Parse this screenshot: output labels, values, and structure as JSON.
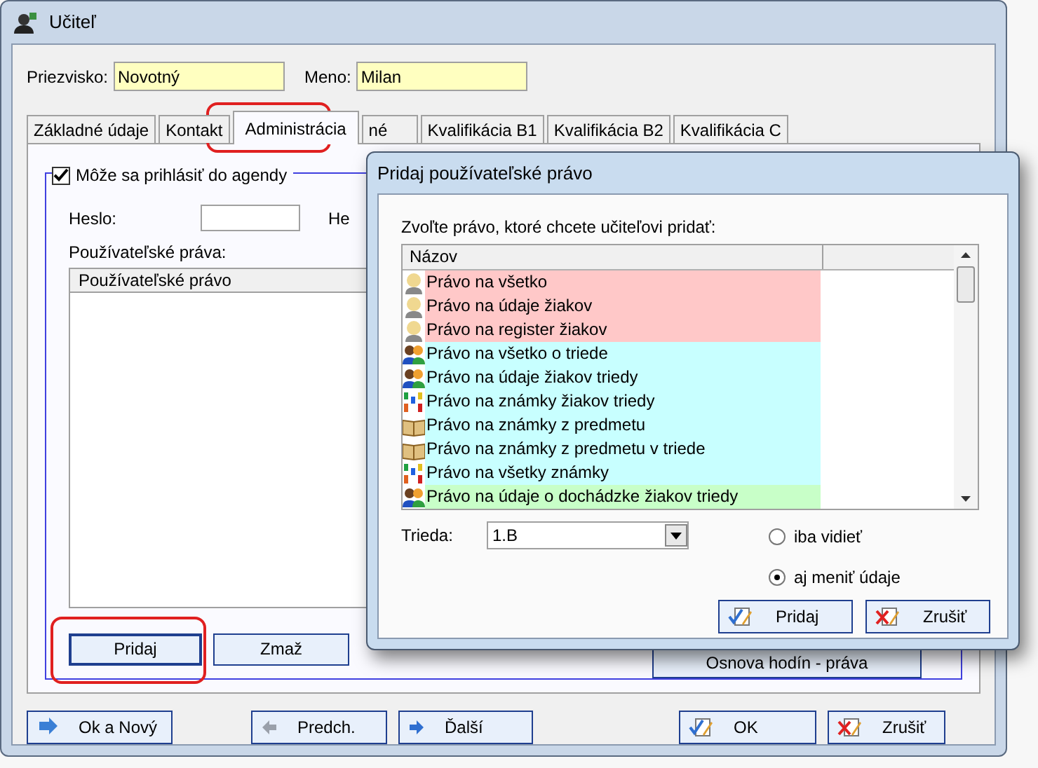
{
  "window": {
    "title": "Učiteľ"
  },
  "fields": [
    {
      "label": "Priezvisko:",
      "value": "Novotný"
    },
    {
      "label": "Meno:",
      "value": "Milan"
    }
  ],
  "tabs": [
    {
      "label": "Základné údaje",
      "selected": false
    },
    {
      "label": "Kontakt",
      "selected": false
    },
    {
      "label": "Administrácia",
      "selected": true
    },
    {
      "label": "né",
      "selected": false
    },
    {
      "label": "Kvalifikácia B1",
      "selected": false
    },
    {
      "label": "Kvalifikácia B2",
      "selected": false
    },
    {
      "label": "Kvalifikácia C",
      "selected": false
    }
  ],
  "admin": {
    "login": {
      "label": "Môže sa prihlásiť do agendy",
      "checked": true
    },
    "password_label": "Heslo:",
    "password_label_2": "He",
    "rights_label": "Používateľské práva:",
    "rights_column": "Používateľské právo",
    "buttons": [
      "Pridaj",
      "Zmaž",
      "Osnova hodín - práva"
    ]
  },
  "footer_buttons": [
    {
      "label": "Ok a Nový",
      "kind": "new"
    },
    {
      "label": "Predch.",
      "kind": "prev"
    },
    {
      "label": "Ďalší",
      "kind": "next"
    },
    {
      "label": "OK",
      "kind": "ok"
    },
    {
      "label": "Zrušiť",
      "kind": "cancel"
    }
  ],
  "dialog": {
    "title": "Pridaj používateľské právo",
    "prompt": "Zvoľte právo, ktoré chcete učiteľovi pridať:",
    "column": "Názov",
    "rows": [
      {
        "name": "Právo na všetko",
        "kind": "person",
        "color": "#ffc8c8"
      },
      {
        "name": "Právo na údaje žiakov",
        "kind": "person",
        "color": "#ffc8c8"
      },
      {
        "name": "Právo na register žiakov",
        "kind": "person",
        "color": "#ffc8c8"
      },
      {
        "name": "Právo na všetko o triede",
        "kind": "group",
        "color": "#c8ffff"
      },
      {
        "name": "Právo na údaje žiakov triedy",
        "kind": "group",
        "color": "#c8ffff"
      },
      {
        "name": "Právo na známky žiakov triedy",
        "kind": "grades",
        "color": "#c8ffff"
      },
      {
        "name": "Právo na známky z predmetu",
        "kind": "book",
        "color": "#c8ffff"
      },
      {
        "name": "Právo na známky z predmetu v triede",
        "kind": "book",
        "color": "#c8ffff"
      },
      {
        "name": "Právo na všetky známky",
        "kind": "grades",
        "color": "#c8ffff"
      },
      {
        "name": "Právo na údaje o dochádzke žiakov triedy",
        "kind": "group",
        "color": "#c8ffc8"
      }
    ],
    "class_label": "Trieda:",
    "class_value": "1.B",
    "options": [
      {
        "label": "iba vidieť",
        "selected": false
      },
      {
        "label": "aj meniť údaje",
        "selected": true
      }
    ],
    "buttons": [
      {
        "label": "Pridaj",
        "kind": "ok"
      },
      {
        "label": "Zrušiť",
        "kind": "cancel"
      }
    ]
  }
}
